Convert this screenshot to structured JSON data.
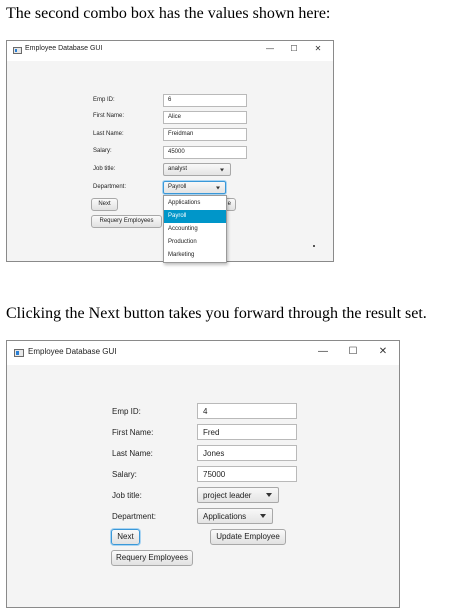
{
  "captions": {
    "top": "The second combo box has the values shown here:",
    "middle": "Clicking the Next button takes you forward through the result set."
  },
  "window1": {
    "title": "Employee Database GUI",
    "controls": {
      "minimize": "—",
      "maximize": "☐",
      "close": "✕"
    },
    "labels": {
      "emp_id": "Emp ID:",
      "first_name": "First Name:",
      "last_name": "Last Name:",
      "salary": "Salary:",
      "job_title": "Job title:",
      "department": "Department:"
    },
    "values": {
      "emp_id": "6",
      "first_name": "Alice",
      "last_name": "Freidman",
      "salary": "45000"
    },
    "job_title_selected": "analyst",
    "department_selected": "Payroll",
    "buttons": {
      "next": "Next",
      "requery": "Requery Employees",
      "update_partial": "e"
    },
    "department_options": [
      "Applications",
      "Payroll",
      "Accounting",
      "Production",
      "Marketing"
    ],
    "department_highlighted_index": 1
  },
  "window2": {
    "title": "Employee Database GUI",
    "controls": {
      "minimize": "—",
      "maximize": "☐",
      "close": "✕"
    },
    "labels": {
      "emp_id": "Emp ID:",
      "first_name": "First Name:",
      "last_name": "Last Name:",
      "salary": "Salary:",
      "job_title": "Job title:",
      "department": "Department:"
    },
    "values": {
      "emp_id": "4",
      "first_name": "Fred",
      "last_name": "Jones",
      "salary": "75000"
    },
    "job_title_selected": "project leader",
    "department_selected": "Applications",
    "buttons": {
      "next": "Next",
      "update": "Update Employee",
      "requery": "Requery Employees"
    }
  },
  "colors": {
    "selection": "#0096c9",
    "focus": "#3a98d8",
    "client_bg": "#f4f4f4"
  },
  "icons": {
    "window": "app-window-icon",
    "dropdown": "chevron-down-icon"
  }
}
